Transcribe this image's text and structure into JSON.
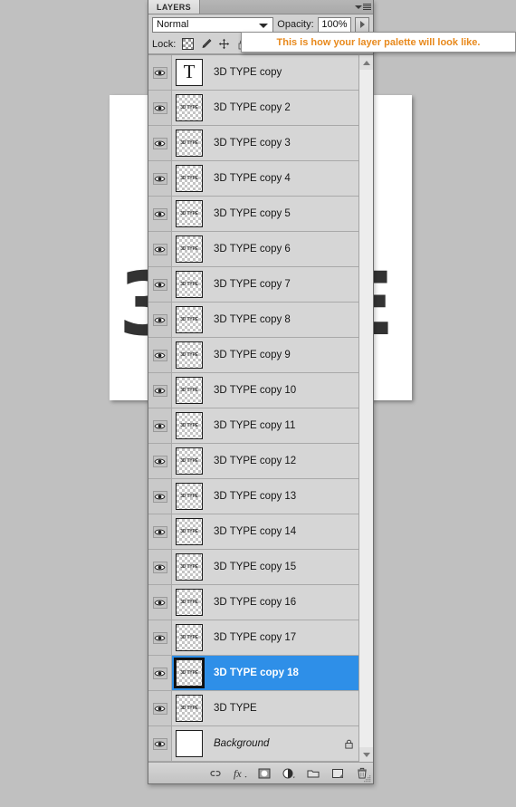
{
  "palette": {
    "tab_label": "LAYERS",
    "panel_menu_icon": "panel-menu-icon",
    "blend_mode": "Normal",
    "opacity_label": "Opacity:",
    "opacity_value": "100%",
    "lock_label": "Lock:",
    "lock_icons": [
      "lock-transparent-pixels-icon",
      "lock-image-pixels-icon",
      "lock-position-icon",
      "lock-all-icon"
    ],
    "accent_selected": "#2e8fe8",
    "tooltip": {
      "text": "This is how your layer palette will look like.",
      "color": "#e8891c"
    }
  },
  "layers": [
    {
      "name": "3D TYPE copy",
      "thumb": "type-T",
      "visible": true,
      "selected": false,
      "locked": false,
      "italic": false
    },
    {
      "name": "3D TYPE copy 2",
      "thumb": "3d-type",
      "visible": true,
      "selected": false,
      "locked": false,
      "italic": false
    },
    {
      "name": "3D TYPE copy 3",
      "thumb": "3d-type",
      "visible": true,
      "selected": false,
      "locked": false,
      "italic": false
    },
    {
      "name": "3D TYPE copy 4",
      "thumb": "3d-type",
      "visible": true,
      "selected": false,
      "locked": false,
      "italic": false
    },
    {
      "name": "3D TYPE copy 5",
      "thumb": "3d-type",
      "visible": true,
      "selected": false,
      "locked": false,
      "italic": false
    },
    {
      "name": "3D TYPE copy 6",
      "thumb": "3d-type",
      "visible": true,
      "selected": false,
      "locked": false,
      "italic": false
    },
    {
      "name": "3D TYPE copy 7",
      "thumb": "3d-type",
      "visible": true,
      "selected": false,
      "locked": false,
      "italic": false
    },
    {
      "name": "3D TYPE copy 8",
      "thumb": "3d-type",
      "visible": true,
      "selected": false,
      "locked": false,
      "italic": false
    },
    {
      "name": "3D TYPE copy 9",
      "thumb": "3d-type",
      "visible": true,
      "selected": false,
      "locked": false,
      "italic": false
    },
    {
      "name": "3D TYPE copy 10",
      "thumb": "3d-type",
      "visible": true,
      "selected": false,
      "locked": false,
      "italic": false
    },
    {
      "name": "3D TYPE copy 11",
      "thumb": "3d-type",
      "visible": true,
      "selected": false,
      "locked": false,
      "italic": false
    },
    {
      "name": "3D TYPE copy 12",
      "thumb": "3d-type",
      "visible": true,
      "selected": false,
      "locked": false,
      "italic": false
    },
    {
      "name": "3D TYPE copy 13",
      "thumb": "3d-type",
      "visible": true,
      "selected": false,
      "locked": false,
      "italic": false
    },
    {
      "name": "3D TYPE copy 14",
      "thumb": "3d-type",
      "visible": true,
      "selected": false,
      "locked": false,
      "italic": false
    },
    {
      "name": "3D TYPE copy 15",
      "thumb": "3d-type",
      "visible": true,
      "selected": false,
      "locked": false,
      "italic": false
    },
    {
      "name": "3D TYPE copy 16",
      "thumb": "3d-type",
      "visible": true,
      "selected": false,
      "locked": false,
      "italic": false
    },
    {
      "name": "3D TYPE copy 17",
      "thumb": "3d-type",
      "visible": true,
      "selected": false,
      "locked": false,
      "italic": false
    },
    {
      "name": "3D TYPE copy 18",
      "thumb": "3d-type",
      "visible": true,
      "selected": true,
      "locked": false,
      "italic": false
    },
    {
      "name": "3D TYPE",
      "thumb": "3d-type",
      "visible": true,
      "selected": false,
      "locked": false,
      "italic": false
    },
    {
      "name": "Background",
      "thumb": "white",
      "visible": true,
      "selected": false,
      "locked": true,
      "italic": true
    }
  ],
  "thumb_text": "3D TYPE",
  "footer_icons": [
    "link-layers-icon",
    "layer-style-fx-icon",
    "layer-mask-icon",
    "adjustment-layer-icon",
    "new-group-icon",
    "new-layer-icon",
    "delete-layer-icon"
  ],
  "canvas": {
    "left_glyph": "3",
    "right_glyph": "E"
  },
  "scrollbar": {
    "up_arrow": "scroll-up-icon",
    "down_arrow": "scroll-down-icon"
  }
}
